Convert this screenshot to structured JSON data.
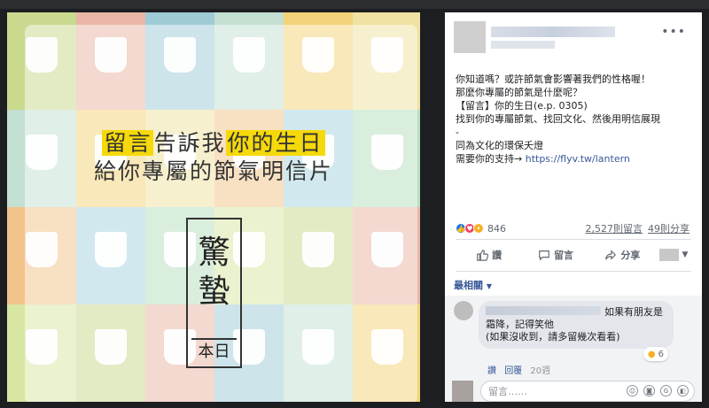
{
  "post": {
    "text_lines": [
      "你知道嗎？或許節氣會影響著我們的性格喔！",
      "那麼你專屬的節氣是什麼呢？",
      "【留言】你的生日(e.p. 0305)",
      "找到你的專屬節氣、找回文化、然後用明信展現",
      "-",
      "同為文化的環保夭燈",
      "需要你的支持→ "
    ],
    "link": "https://flyv.tw/lantern",
    "reaction_count": "846",
    "comments_count": "2,527則留言",
    "shares_count": "49則分享",
    "actions": {
      "like": "讚",
      "comment": "留言",
      "share": "分享"
    },
    "sort_label": "最相關",
    "more_icon": "•••"
  },
  "image": {
    "headline_1_hl_a": "留言",
    "headline_1_plain": "告訴我",
    "headline_1_hl_b": "你的生日",
    "headline_2": "給你專屬的節氣明信片",
    "stamp_big": "驚蟄",
    "stamp_sub": "本日"
  },
  "comment": {
    "text_1": "如果有朋友是",
    "text_2": "霜降，記得笑他",
    "text_3": "(如果沒收到，請多留幾次看看)",
    "reaction_count": "6",
    "like": "讚",
    "reply": "回覆",
    "time": "20週"
  },
  "input": {
    "placeholder": "留言……",
    "icons": [
      "smiley-icon",
      "camera-icon",
      "gif-icon",
      "sticker-icon"
    ]
  },
  "colors": {
    "accent_yellow": "#f5d90a",
    "link_blue": "#385898",
    "like_blue": "#1877f2",
    "love_red": "#f33e58",
    "wow_yellow": "#f7b125"
  }
}
